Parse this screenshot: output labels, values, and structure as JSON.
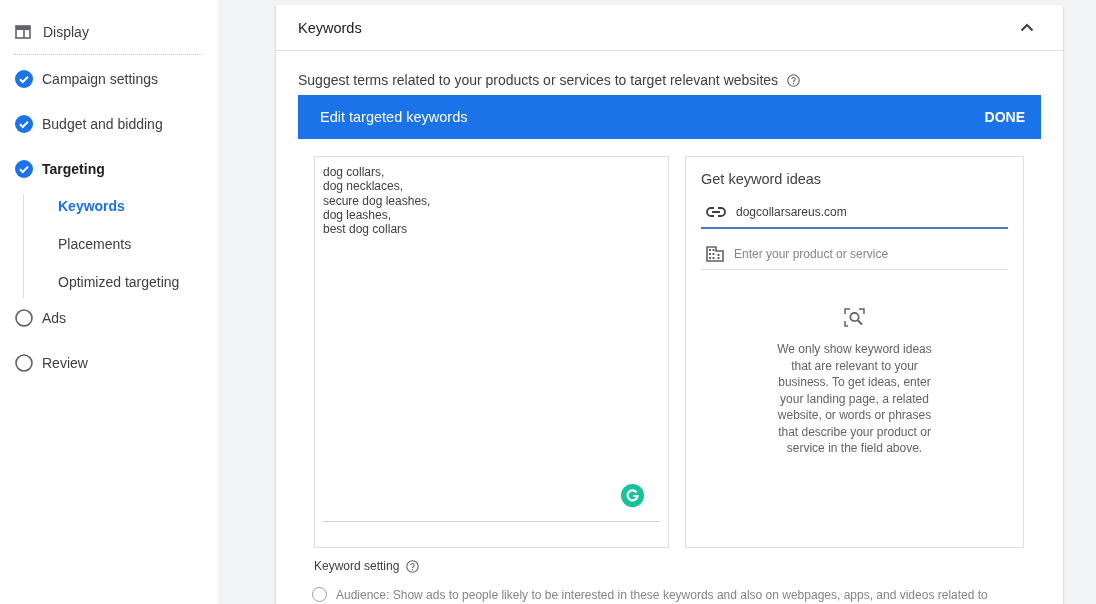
{
  "sidebar": {
    "campaign_type": "Display",
    "steps": [
      {
        "label": "Campaign settings",
        "completed": true,
        "current": false
      },
      {
        "label": "Budget and bidding",
        "completed": true,
        "current": false
      },
      {
        "label": "Targeting",
        "completed": true,
        "current": true,
        "children": [
          {
            "label": "Keywords",
            "selected": true
          },
          {
            "label": "Placements",
            "selected": false
          },
          {
            "label": "Optimized targeting",
            "selected": false
          }
        ]
      },
      {
        "label": "Ads",
        "completed": false,
        "current": false
      },
      {
        "label": "Review",
        "completed": false,
        "current": false
      }
    ]
  },
  "card": {
    "title": "Keywords",
    "expanded": true,
    "description": "Suggest terms related to your products or services to target relevant websites",
    "editor": {
      "title": "Edit targeted keywords",
      "done_button": "DONE",
      "keywords": "dog collars,\ndog necklaces,\nsecure dog leashes,\ndog leashes,\nbest dog collars",
      "ideas": {
        "title": "Get keyword ideas",
        "fields": [
          {
            "kind": "url",
            "value": "dogcollarsareus.com",
            "focused": true
          },
          {
            "kind": "product",
            "placeholder": "Enter your product or service",
            "focused": false
          }
        ],
        "message": "We only show keyword ideas that are relevant to your business. To get ideas, enter your landing page, a related website, or words or phrases that describe your product or service in the field above."
      }
    },
    "keyword_setting": {
      "label": "Keyword setting",
      "options": [
        {
          "label": "Audience: Show ads to people likely to be interested in these keywords and also on webpages, apps, and videos related to",
          "selected": false
        }
      ]
    }
  }
}
